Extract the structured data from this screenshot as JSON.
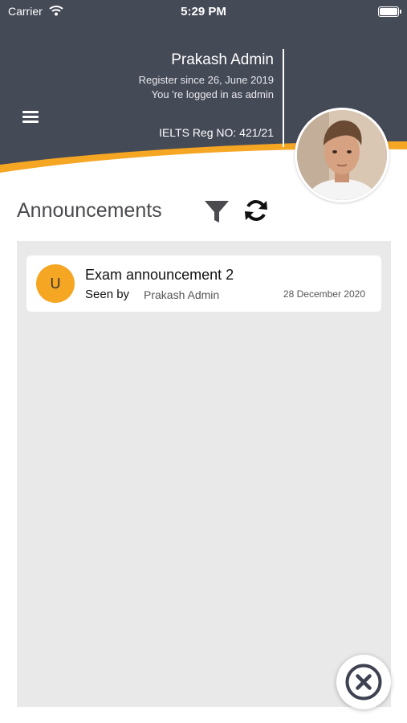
{
  "colors": {
    "header_bg": "#454a57",
    "accent": "#f5a623",
    "panel_bg": "#e9e9e9"
  },
  "status_bar": {
    "carrier": "Carrier",
    "time": "5:29 PM"
  },
  "profile": {
    "name": "Prakash Admin",
    "registered": "Register since 26, June 2019",
    "role_text": "You 're logged in as admin",
    "reg_no": "IELTS Reg NO: 421/21"
  },
  "page": {
    "title": "Announcements"
  },
  "announcements": [
    {
      "avatar_letter": "U",
      "title": "Exam announcement 2",
      "seen_label": "Seen by",
      "seen_by": "Prakash Admin",
      "date": "28 December 2020"
    }
  ],
  "icons": {
    "menu": "hamburger-icon",
    "filter": "filter-icon",
    "refresh": "refresh-icon",
    "close": "close-circle-icon",
    "wifi": "wifi-icon",
    "battery": "battery-icon"
  }
}
